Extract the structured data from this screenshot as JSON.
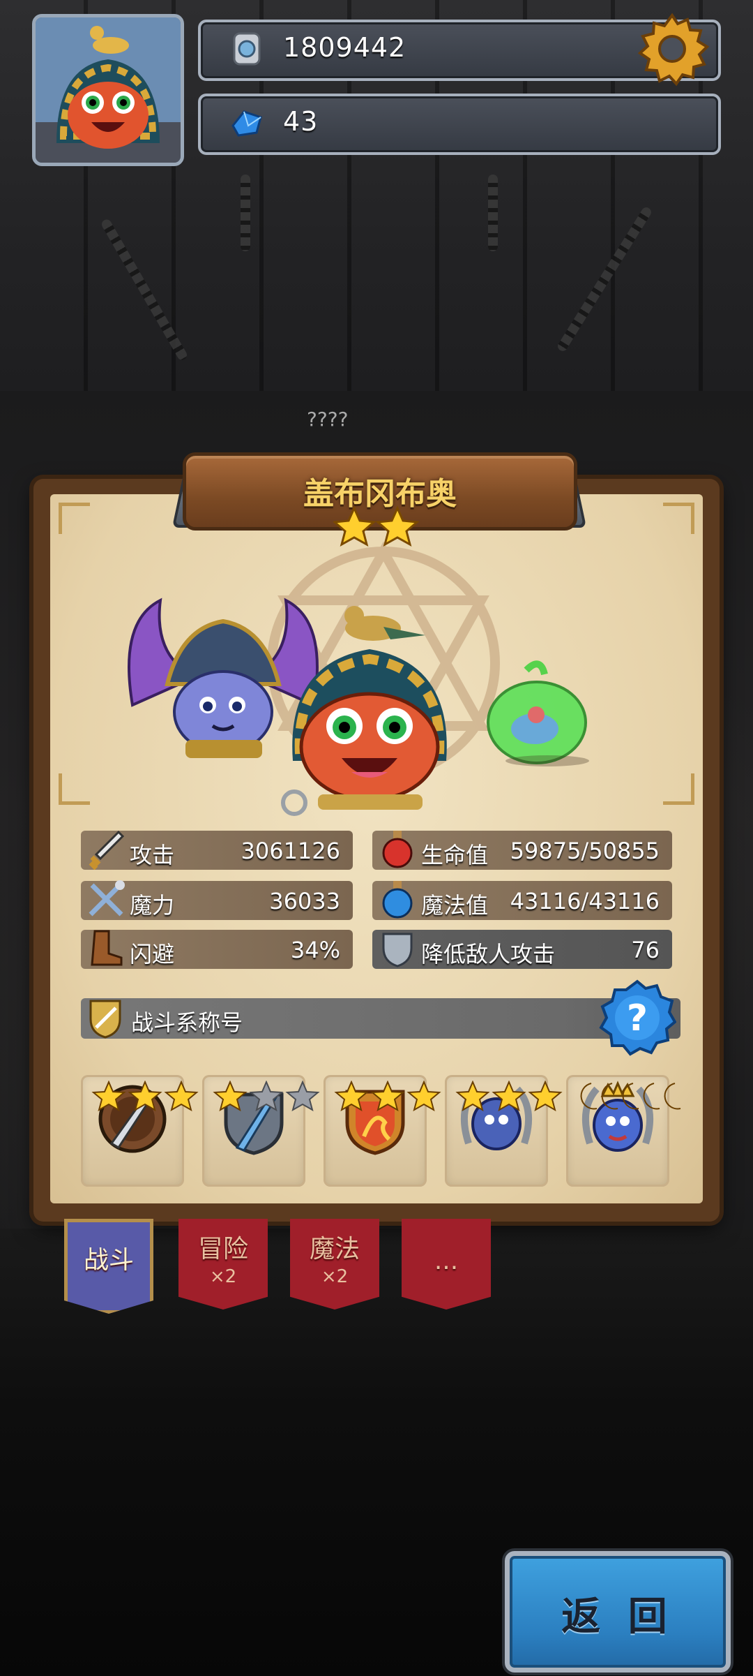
{
  "header": {
    "coins": "1809442",
    "gems": "43"
  },
  "background": {
    "unknown_label": "????"
  },
  "hero": {
    "name": "盖布冈布奥",
    "star_count": 2
  },
  "stats": {
    "attack": {
      "label": "攻击",
      "value": "3061126"
    },
    "magic_power": {
      "label": "魔力",
      "value": "36033"
    },
    "dodge": {
      "label": "闪避",
      "value": "34%"
    },
    "hp": {
      "label": "生命值",
      "value": "59875/50855"
    },
    "mp": {
      "label": "魔法值",
      "value": "43116/43116"
    },
    "reduce_enemy_attack": {
      "label": "降低敌人攻击",
      "value": "76"
    }
  },
  "battle_title": {
    "label": "战斗系称号"
  },
  "medals": [
    {
      "icon": "spear-shield-medal-icon",
      "stars": [
        1,
        1,
        1
      ],
      "type": "star"
    },
    {
      "icon": "silver-spear-shield-medal-icon",
      "stars": [
        1,
        0,
        0
      ],
      "type": "star"
    },
    {
      "icon": "flame-shield-medal-icon",
      "stars": [
        1,
        1,
        1
      ],
      "type": "star"
    },
    {
      "icon": "laurel-monster-medal-icon",
      "stars": [
        1,
        1,
        1
      ],
      "type": "star"
    },
    {
      "icon": "crowned-monster-medal-icon",
      "stars": [
        1,
        1,
        1,
        1,
        1
      ],
      "type": "moon"
    }
  ],
  "tabs": [
    {
      "label": "战斗",
      "sub": "",
      "active": true
    },
    {
      "label": "冒险",
      "sub": "×2",
      "active": false
    },
    {
      "label": "魔法",
      "sub": "×2",
      "active": false
    },
    {
      "label": "...",
      "sub": "",
      "active": false
    }
  ],
  "buttons": {
    "return_label": "返 回"
  },
  "colors": {
    "gold": "#f7d268",
    "panel_parchment": "#e6d2a9",
    "tab_red": "#a01f2a",
    "tab_active": "#585aa8",
    "return_blue": "#2b7fc0"
  }
}
